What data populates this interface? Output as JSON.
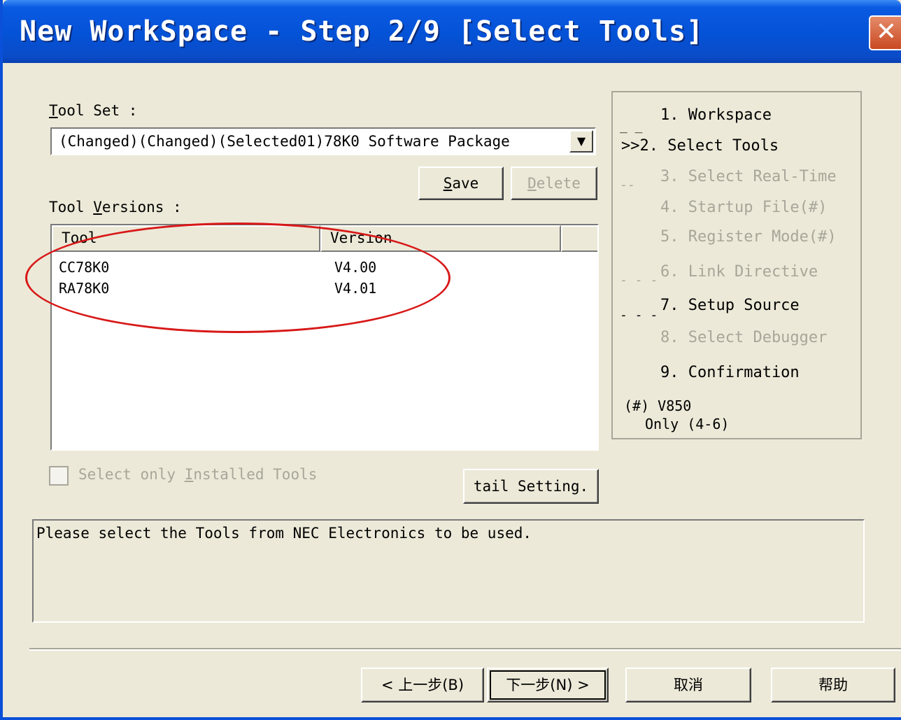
{
  "window": {
    "title": "New WorkSpace - Step 2/9 [Select Tools]",
    "close_glyph": "✕"
  },
  "tool_set": {
    "label_accel": "T",
    "label_rest": "ool Set :",
    "selected_value": "(Changed)(Changed)(Selected01)78K0 Software Package",
    "dropdown_glyph": "▼"
  },
  "buttons": {
    "save_accel": "S",
    "save_rest": "ave",
    "delete_accel": "D",
    "delete_rest": "elete",
    "detail_setting": "tail Setting.",
    "back": "< 上一步(B)",
    "next": "下一步(N) >",
    "cancel": "取消",
    "help": "帮助"
  },
  "tool_versions": {
    "label_pre": "Tool ",
    "label_accel": "V",
    "label_rest": "ersions :",
    "columns": [
      "Tool",
      "Version"
    ],
    "rows": [
      {
        "tool": "CC78K0",
        "version": "V4.00"
      },
      {
        "tool": "RA78K0",
        "version": "V4.01"
      }
    ]
  },
  "installed_only": {
    "label_pre": "Select only ",
    "label_accel": "I",
    "label_rest": "nstalled Tools",
    "checked": false
  },
  "steps": {
    "items": [
      {
        "label": "1. Workspace",
        "state": "done"
      },
      {
        "label": ">>2. Select Tools",
        "state": "current"
      },
      {
        "label": "3. Select Real-Time",
        "state": "disabled"
      },
      {
        "label": "4. Startup File(#)",
        "state": "disabled"
      },
      {
        "label": "5. Register Mode(#)",
        "state": "disabled"
      },
      {
        "label": "6. Link Directive",
        "state": "disabled"
      },
      {
        "label": "7. Setup Source",
        "state": "enabled"
      },
      {
        "label": "8. Select Debugger",
        "state": "disabled"
      },
      {
        "label": "9. Confirmation",
        "state": "enabled"
      }
    ],
    "note_line1": "(#) V850",
    "note_line2": "Only (4-6)"
  },
  "message": "Please select the Tools from NEC Electronics to be used.",
  "colors": {
    "title_blue": "#0452d6",
    "dialog_bg": "#ece9d8",
    "annotation_red": "#d81818",
    "disabled_text": "#a8a699"
  }
}
